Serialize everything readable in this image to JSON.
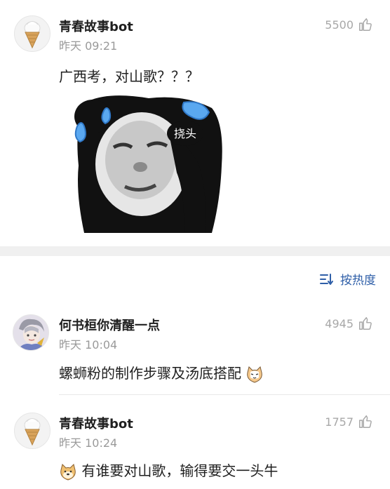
{
  "post": {
    "user": "青春故事bot",
    "time": "昨天 09:21",
    "likes": "5500",
    "text": "广西考，对山歌？？？",
    "sticker_caption": "挠头"
  },
  "sort": {
    "label": "按热度"
  },
  "comments": [
    {
      "user": "何书桓你清醒一点",
      "time": "昨天 10:04",
      "likes": "4945",
      "text": "螺蛳粉的制作步骤及汤底搭配"
    },
    {
      "user": "青春故事bot",
      "time": "昨天 10:24",
      "likes": "1757",
      "text": "有谁要对山歌，输得要交一头牛"
    }
  ],
  "colors": {
    "accent": "#2f5fa8",
    "muted": "#9a9a9a",
    "band": "#f0f0f0"
  }
}
